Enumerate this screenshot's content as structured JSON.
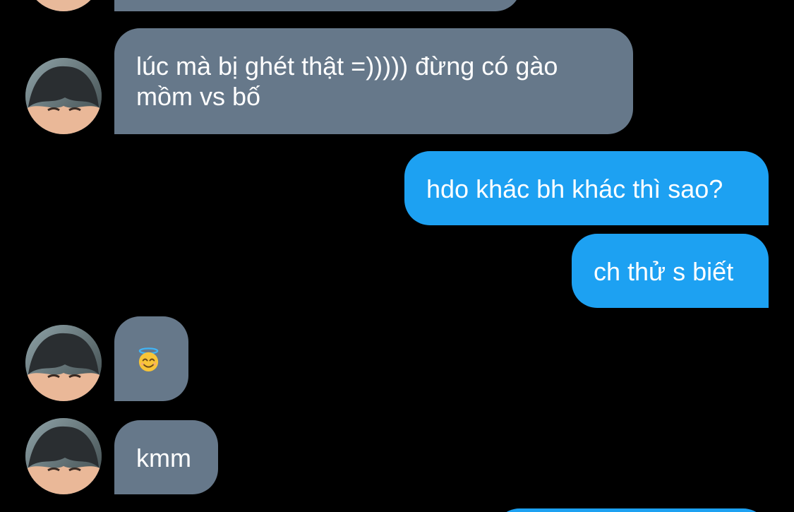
{
  "theme": {
    "background": "#000000",
    "incoming_bubble": "#66788a",
    "outgoing_bubble": "#1da1f2",
    "text": "#ffffff"
  },
  "conversation": {
    "messages": [
      {
        "direction": "incoming",
        "text": "",
        "partial": true
      },
      {
        "direction": "incoming",
        "line1": "lúc mà bị ghét thật =))))) đừng có gào",
        "line2": "mồm vs bố"
      },
      {
        "direction": "outgoing",
        "text": "hdo khác bh khác thì sao?"
      },
      {
        "direction": "outgoing",
        "text": "ch thử s biết"
      },
      {
        "direction": "incoming",
        "emoji": "smiling-face-with-halo",
        "text": ""
      },
      {
        "direction": "incoming",
        "text": "kmm"
      },
      {
        "direction": "outgoing",
        "text": "",
        "partial": true
      }
    ]
  },
  "avatar": {
    "icon": "contact-photo-icon"
  }
}
